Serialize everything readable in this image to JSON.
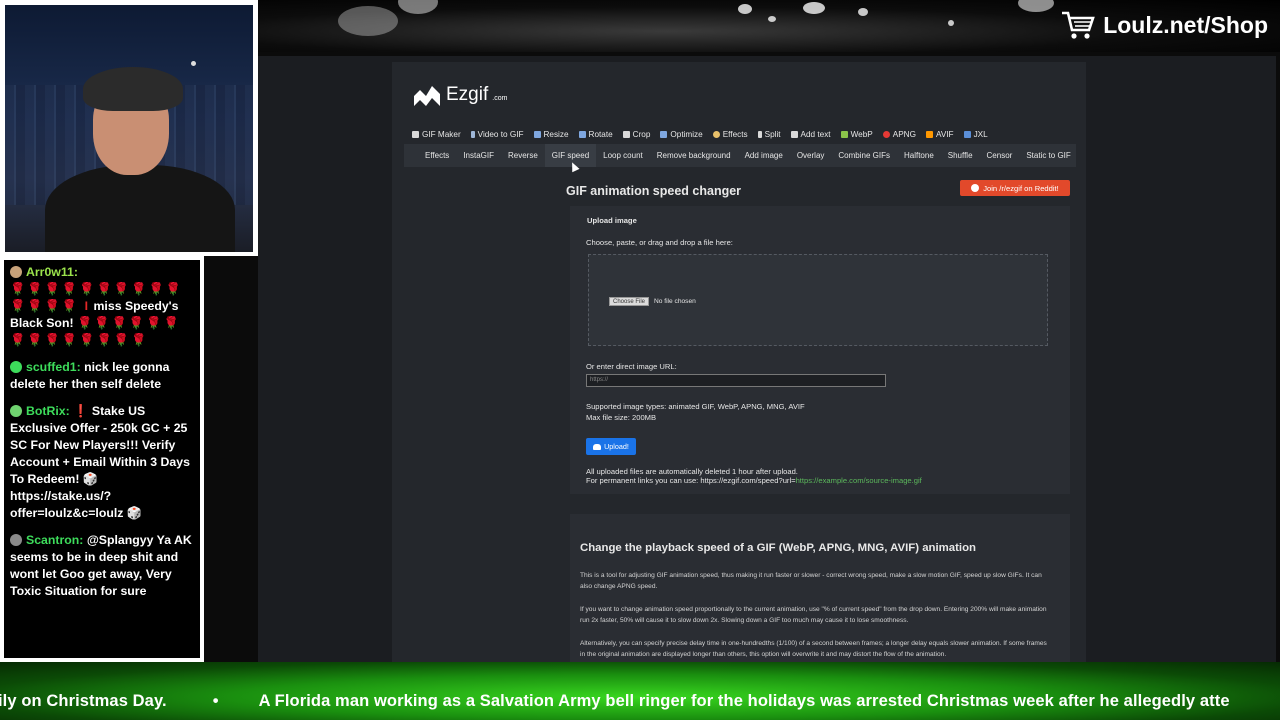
{
  "overlay": {
    "shop_label": "Loulz.net/Shop",
    "ticker": {
      "left": "ily on Christmas Day.",
      "separator": "•",
      "right": "A Florida man working as a Salvation Army bell ringer for the holidays was arrested Christmas week after he allegedly atte"
    }
  },
  "chat": {
    "messages": [
      {
        "user": "Arr0w11:",
        "user_color": "#9be34c",
        "text": "miss Speedy's Black Son!",
        "pre": "🌹🌹🌹🌹🌹🌹🌹🌹🌹🌹🌹🌹🌹🌹 I",
        "post": "🌹🌹🌹🌹🌹🌹🌹🌹🌹🌹🌹🌹🌹🌹"
      },
      {
        "user": "scuffed1:",
        "user_color": "#3ddc5b",
        "text": "nick lee gonna delete her then self delete"
      },
      {
        "user": "BotRix:",
        "user_color": "#3ddc5b",
        "text": "❗ Stake US Exclusive Offer - 250k GC + 25 SC For New Players!!! Verify Account + Email Within 3 Days To Redeem! 🎲 https://stake.us/?offer=loulz&c=loulz 🎲"
      },
      {
        "user": "Scantron:",
        "user_color": "#3ddc5b",
        "text": "@Splangyy Ya AK seems to be in deep shit and wont let Goo get away, Very Toxic Situation for sure"
      }
    ]
  },
  "site": {
    "logo_text": "Ezgif",
    "logo_suffix": ".com",
    "nav": [
      {
        "label": "GIF Maker",
        "color": "#d9d9d9"
      },
      {
        "label": "Video to GIF",
        "color": "#9fb7d8"
      },
      {
        "label": "Resize",
        "color": "#7fa7e0"
      },
      {
        "label": "Rotate",
        "color": "#7fa7e0"
      },
      {
        "label": "Crop",
        "color": "#d9d9d9"
      },
      {
        "label": "Optimize",
        "color": "#7fa7e0"
      },
      {
        "label": "Effects",
        "color": "#e8c06a"
      },
      {
        "label": "Split",
        "color": "#d9d9d9"
      },
      {
        "label": "Add text",
        "color": "#d9d9d9"
      },
      {
        "label": "WebP",
        "color": "#8bc34a"
      },
      {
        "label": "APNG",
        "color": "#e53935"
      },
      {
        "label": "AVIF",
        "color": "#ff9800"
      },
      {
        "label": "JXL",
        "color": "#5b8fd8"
      }
    ],
    "subnav": [
      "Effects",
      "InstaGIF",
      "Reverse",
      "GIF speed",
      "Loop count",
      "Remove background",
      "Add image",
      "Overlay",
      "Combine GIFs",
      "Halftone",
      "Shuffle",
      "Censor",
      "Static to GIF"
    ],
    "subnav_active": "GIF speed",
    "title": "GIF animation speed changer",
    "reddit_button": "Join /r/ezgif on Reddit!",
    "upload": {
      "heading": "Upload image",
      "choose_label": "Choose, paste, or drag and drop a file here:",
      "file_button": "Choose File",
      "file_status": "No file chosen",
      "url_label": "Or enter direct image URL:",
      "url_placeholder": "https://",
      "supported": "Supported image types: animated GIF, WebP, APNG, MNG, AVIF",
      "max_size": "Max file size: 200MB",
      "upload_button": "Upload!",
      "note_1": "All uploaded files are automatically deleted 1 hour after upload.",
      "note_2_prefix": "For permanent links you can use: https://ezgif.com/speed?url=",
      "note_2_link": "https://example.com/source-image.gif"
    },
    "info": {
      "heading": "Change the playback speed of a GIF (WebP, APNG, MNG, AVIF) animation",
      "p1": "This is a tool for adjusting GIF animation speed, thus making it run faster or slower - correct wrong speed, make a slow motion GIF, speed up slow GIFs. It can also change APNG speed.",
      "p2": "If you want to change animation speed proportionally to the current animation, use \"% of current speed\" from the drop down. Entering 200% will make animation run 2x faster, 50% will cause it to slow down 2x. Slowing down a GIF too much may cause it to lose smoothness.",
      "p3": "Alternatively, you can specify precise delay time in one-hundredths (1/100) of a second between frames; a longer delay equals slower animation. If some frames in the original animation are displayed longer than others, this option will overwrite it and may distort the flow of the animation."
    }
  }
}
